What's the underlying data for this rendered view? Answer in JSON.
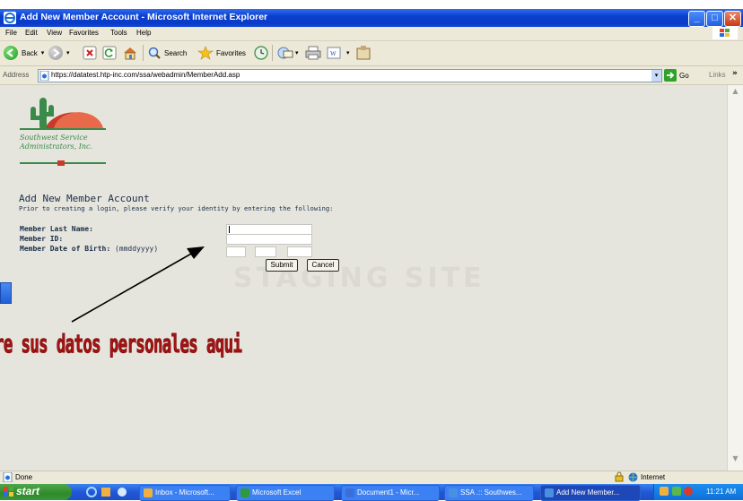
{
  "window": {
    "title": "Add New Member Account - Microsoft Internet Explorer",
    "controls": [
      "minimize",
      "maximize",
      "close"
    ]
  },
  "menu": [
    "File",
    "Edit",
    "View",
    "Favorites",
    "Tools",
    "Help"
  ],
  "toolbar": {
    "back_label": "Back",
    "search_label": "Search",
    "favorites_label": "Favorites"
  },
  "address": {
    "label": "Address",
    "url": "https://datatest.htp-inc.com/ssa/webadmin/MemberAdd.asp",
    "go_label": "Go",
    "links_label": "Links"
  },
  "page": {
    "logo_text_line1": "Southwest Service",
    "logo_text_line2": "Administrators, Inc.",
    "heading": "Add New Member Account",
    "subheading": "Prior to creating a login, please verify your identity by entering the following:",
    "fields": {
      "last_name_label": "Member Last Name:",
      "member_id_label": "Member ID:",
      "dob_label": "Member Date of Birth:",
      "dob_hint": "(mmddyyyy)"
    },
    "submit_label": "Submit",
    "cancel_label": "Cancel",
    "watermark": "STAGING SITE"
  },
  "annotation": {
    "text": "re sus datos personales aqui"
  },
  "status": {
    "text": "Done",
    "zone": "Internet"
  },
  "taskbar": {
    "start_label": "start",
    "tasks": [
      {
        "label": "Inbox - Microsoft...",
        "color": "#f0b040"
      },
      {
        "label": "Microsoft Excel",
        "color": "#2e9a3e"
      },
      {
        "label": "Document1 - Micr...",
        "color": "#3a6fd8"
      },
      {
        "label": "SSA .:: Southwes...",
        "color": "#4a90e0"
      },
      {
        "label": "Add New Member...",
        "color": "#4a90e0"
      }
    ],
    "clock": "11:21 AM"
  },
  "colors": {
    "titlebar": "#0a3fd0",
    "annotation_red": "#a61414",
    "taskbar": "#2158d6",
    "start_green": "#2f8a2a"
  }
}
